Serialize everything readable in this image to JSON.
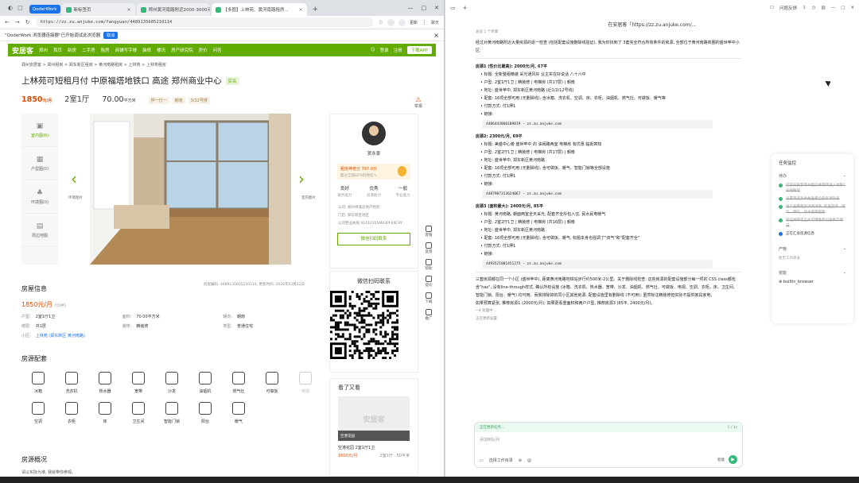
{
  "browser": {
    "tabs": [
      {
        "label": "QoderWork"
      },
      {
        "label": "新标签页"
      },
      {
        "label": "郑州黄河南路附近2000-3000元…"
      },
      {
        "label": "【多图】上林苑、黄河南路租房…"
      }
    ],
    "url": "https://zz.zu.anjuke.com/fangyuan/4489135605210114",
    "toolbar_update": "更新",
    "toolbar_chat": "聊天",
    "notice": "\"QoderWork 浏览器连接器\"已开始调试此浏览器",
    "notice_button": "取消"
  },
  "site": {
    "logo": "安居客",
    "city": "郑州",
    "nav": [
      "首页",
      "新房",
      "二手房",
      "租房",
      "商铺写字楼",
      "装修",
      "楼讯",
      "房产研究院",
      "房价",
      "问答"
    ],
    "login": "登录",
    "register": "注册",
    "download": "下载APP",
    "breadcrumb": "郑州安居客 > 郑州租房 > 郑东新区租房 > 黄河南路租房 > 上林苑 > 上林苑租房",
    "title": "上林苑可短租月付 中原福塔地铁口 高途 郑州商业中心",
    "title_tag": "实名",
    "price": "1850",
    "price_unit": "元/月",
    "layout": "2室1厅",
    "area": "70.00",
    "area_unit": "平方米",
    "chips": [
      "押一付一",
      "朝南",
      "3/12号楼"
    ],
    "report": "举报",
    "gallery_labels": [
      "室内图(6)",
      "户型图(0)",
      "环境图(0)",
      "周边地图"
    ],
    "gallery_prev": "环境图片",
    "gallery_next": "室内图片",
    "agent": {
      "name": "贺永豪",
      "score_label": "租房神奇分 797.0分",
      "score_sub": "超过全城82%的经纪人",
      "ratings": [
        {
          "value": "良好",
          "label": "服务能力"
        },
        {
          "value": "优秀",
          "label": "房源能力"
        },
        {
          "value": "一般",
          "label": "专业能力"
        }
      ],
      "company": "公司: 郑州禄溪房地产经纪",
      "store": "门店: 郑东新区地区",
      "license": "公司营业执照 91410105MA3PF6XC9Y",
      "wx_button": "微信扫码联系"
    },
    "qr_title": "微信扫码联系",
    "see_title": "看了又看",
    "see_img": "安居客",
    "see_img_bar": "空港花园",
    "see_name": "空港花园 2室1厅1卫",
    "see_price": "1600元/月",
    "see_area": "2室1厅 · 50平米",
    "info_title": "房屋信息",
    "info_meta": "房屋编码: 4489135605210114, 更新时间: 2026年03月22日",
    "info_price": "1850元/月",
    "info_pay": "付1押1",
    "info_rows": [
      [
        {
          "k": "户型:",
          "v": "2室1厅1卫"
        },
        {
          "k": "面积:",
          "v": "70.00平方米"
        },
        {
          "k": "朝向:",
          "v": "朝南"
        }
      ],
      [
        {
          "k": "楼层:",
          "v": "共1层"
        },
        {
          "k": "装修:",
          "v": "精装修"
        },
        {
          "k": "类型:",
          "v": "普通住宅"
        }
      ]
    ],
    "info_community_label": "小区:",
    "info_community": "上林苑 (郑东新区 黄河南路)",
    "amen_title": "房源配套",
    "amenities": [
      {
        "label": "冰箱",
        "on": true
      },
      {
        "label": "洗衣机",
        "on": true
      },
      {
        "label": "热水器",
        "on": true
      },
      {
        "label": "宽带",
        "on": true
      },
      {
        "label": "沙发",
        "on": true
      },
      {
        "label": "油烟机",
        "on": true
      },
      {
        "label": "燃气灶",
        "on": true
      },
      {
        "label": "可做饭",
        "on": true
      },
      {
        "label": "电视",
        "on": false
      },
      {
        "label": "空调",
        "on": true
      },
      {
        "label": "衣柜",
        "on": true
      },
      {
        "label": "床",
        "on": true
      },
      {
        "label": "卫生间",
        "on": true
      },
      {
        "label": "智能门锁",
        "on": true
      },
      {
        "label": "阳台",
        "on": true
      },
      {
        "label": "暖气",
        "on": true
      }
    ],
    "overview_title": "房源概况",
    "overview_text": "请以实际为准, 我就带你参观。",
    "rail": [
      "客服",
      "反馈",
      "帮助",
      "提问",
      "下载",
      "推广"
    ]
  },
  "app": {
    "title": "在安居客「https://zz.zu.anjuke.com/…",
    "header_right": "问题反馈",
    "meta": "总览 1 个步骤",
    "intro": "经过对黄河南路附近大量房源的逐一检查 (包括配套设施删除线验证), 我为你找到了 3套完全符合所有条件的房源, 全部位于黄河南路商圈的盛世苹中小区:",
    "listings": [
      {
        "header": "房源1 (性价比最高): 2000元/月, 67平",
        "lines": [
          "标题: 全新整租精装 采光通风好 业主实在好说话 八十六中",
          "户型: 2室1厅1卫 | 精装修 | 电梯房 (共17层) | 朝南",
          "地址: 盛世苹中, 郑东新区黄河南路 (近1/2/12号线)",
          "配套: 16项全部可用 (无删除线), 含冰箱、洗衣机、空调、床、衣柜、油烟机、燃气灶、可做饭、暖气等",
          "付款方式: 付1押1",
          "链接:"
        ],
        "link": "4486443860109019 · zz.zu.anjuke.com"
      },
      {
        "header": "房源2: 2300元/月, 69平",
        "lines": [
          "标题: 美盛中心旁 盛世苹中 的 油阀路两室 电梯房 有优惠 临街寄知",
          "户型: 2室2厅1卫 | 精装修 | 电梯房 (共17层) | 朝南",
          "地址: 盛世苹中, 郑东新区黄河南路",
          "配套: 16项全部可用 (无删除线), 含可做饭、暖气、智能门锁等全部设施",
          "付款方式: 付1押1",
          "链接:"
        ],
        "link": "4487907313624067 · zz.zu.anjuke.com"
      },
      {
        "header": "房源3 (面积最大): 2400元/月, 85平",
        "lines": [
          "标题: 黄河南路, 朝面两室全天采光, 配套齐全拎包入住, 民水民电暖气",
          "户型: 2室2厅1卫 | 精装修 | 电梯房 (共16层) | 朝南",
          "地址: 盛世苹中, 郑东新区黄河南路",
          "配套: 16项全部可用 (无删除线), 含可做饭、暖气, 标题本身也强调了\"双气\"和\"配套齐全\"",
          "付款方式: 付1押1",
          "链接:"
        ],
        "link": "4493521081451275 · zz.zu.anjuke.com"
      }
    ],
    "summary": "三套房源都在同一个小区 (盛世苹中), 距离黄河南路地铁站步行约500米-2公里。关于删除线检查: 这些房源的配套设施部分每一项的 CSS class都包含\"has\", 没有line-through样式, 确认所有设施 (冰箱、洗衣机、热水器、宽带、沙发、油烟机、燃气灶、可做饭、电视、空调、衣柜、床、卫生间、智能门锁、阳台、暖气) 均可用。而我排除掉的同小区其他房源, 配套设施里有删除线 (不可用), 虽然标注精装修但实际不提供家具家电。",
    "recommend": "如果预算紧张, 推荐房源1 (2000元/月); 如果更看重面积和两户户型, 推荐房源3 (85平, 2400元/月)。",
    "thinking": "~4 处理中…",
    "next": "正在更新设置",
    "composer_status": "正在更新任务…",
    "composer_status_right": "1 / 1s",
    "composer_placeholder": "添加到队列",
    "composer_tool": "选择工作目录",
    "composer_mode": "智能",
    "task_panel": {
      "title": "任务监控",
      "todo_label": "待办",
      "items": [
        {
          "text": "打开安居客郑州租房并跳转进入地铁1号线附近",
          "done": true
        },
        {
          "text": "设置筛选条件并查看全部房源列表",
          "done": true
        },
        {
          "text": "逐个查看租房详情详情, 检查空调、暖气、燃气、热水器等配套",
          "done": true
        },
        {
          "text": "验证并筛选正式可用性和设施真实情况",
          "done": true
        },
        {
          "text": "正在汇总房源信息",
          "done": false
        }
      ],
      "output_label": "产物",
      "output_empty": "暂无工作目录",
      "skills_label": "技能",
      "skill": "builtin_browser"
    }
  }
}
